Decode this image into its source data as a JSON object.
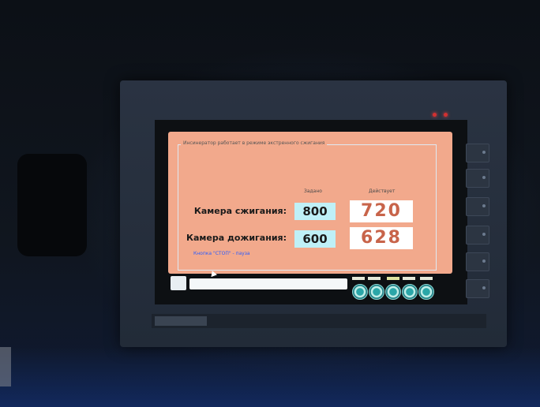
{
  "hmi": {
    "status_message": "Инсинератор работает в режиме экстренного сжигания",
    "columns": {
      "set": "Задано",
      "actual": "Действует"
    },
    "rows": [
      {
        "label": "Камера сжигания:",
        "set": "800",
        "actual": "720"
      },
      {
        "label": "Камера дожигания:",
        "set": "600",
        "actual": "628"
      }
    ],
    "hint": "Кнопка \"СТОП\" - пауза",
    "footer_buttons": 5
  },
  "colors": {
    "panel_bg": "#f2a98c",
    "set_box": "#bff0f7",
    "actual_text": "#c8644a",
    "hint": "#2a5cff",
    "led": "#d23030"
  },
  "icons": [
    "alarm-bell-icon",
    "round-function-button"
  ]
}
